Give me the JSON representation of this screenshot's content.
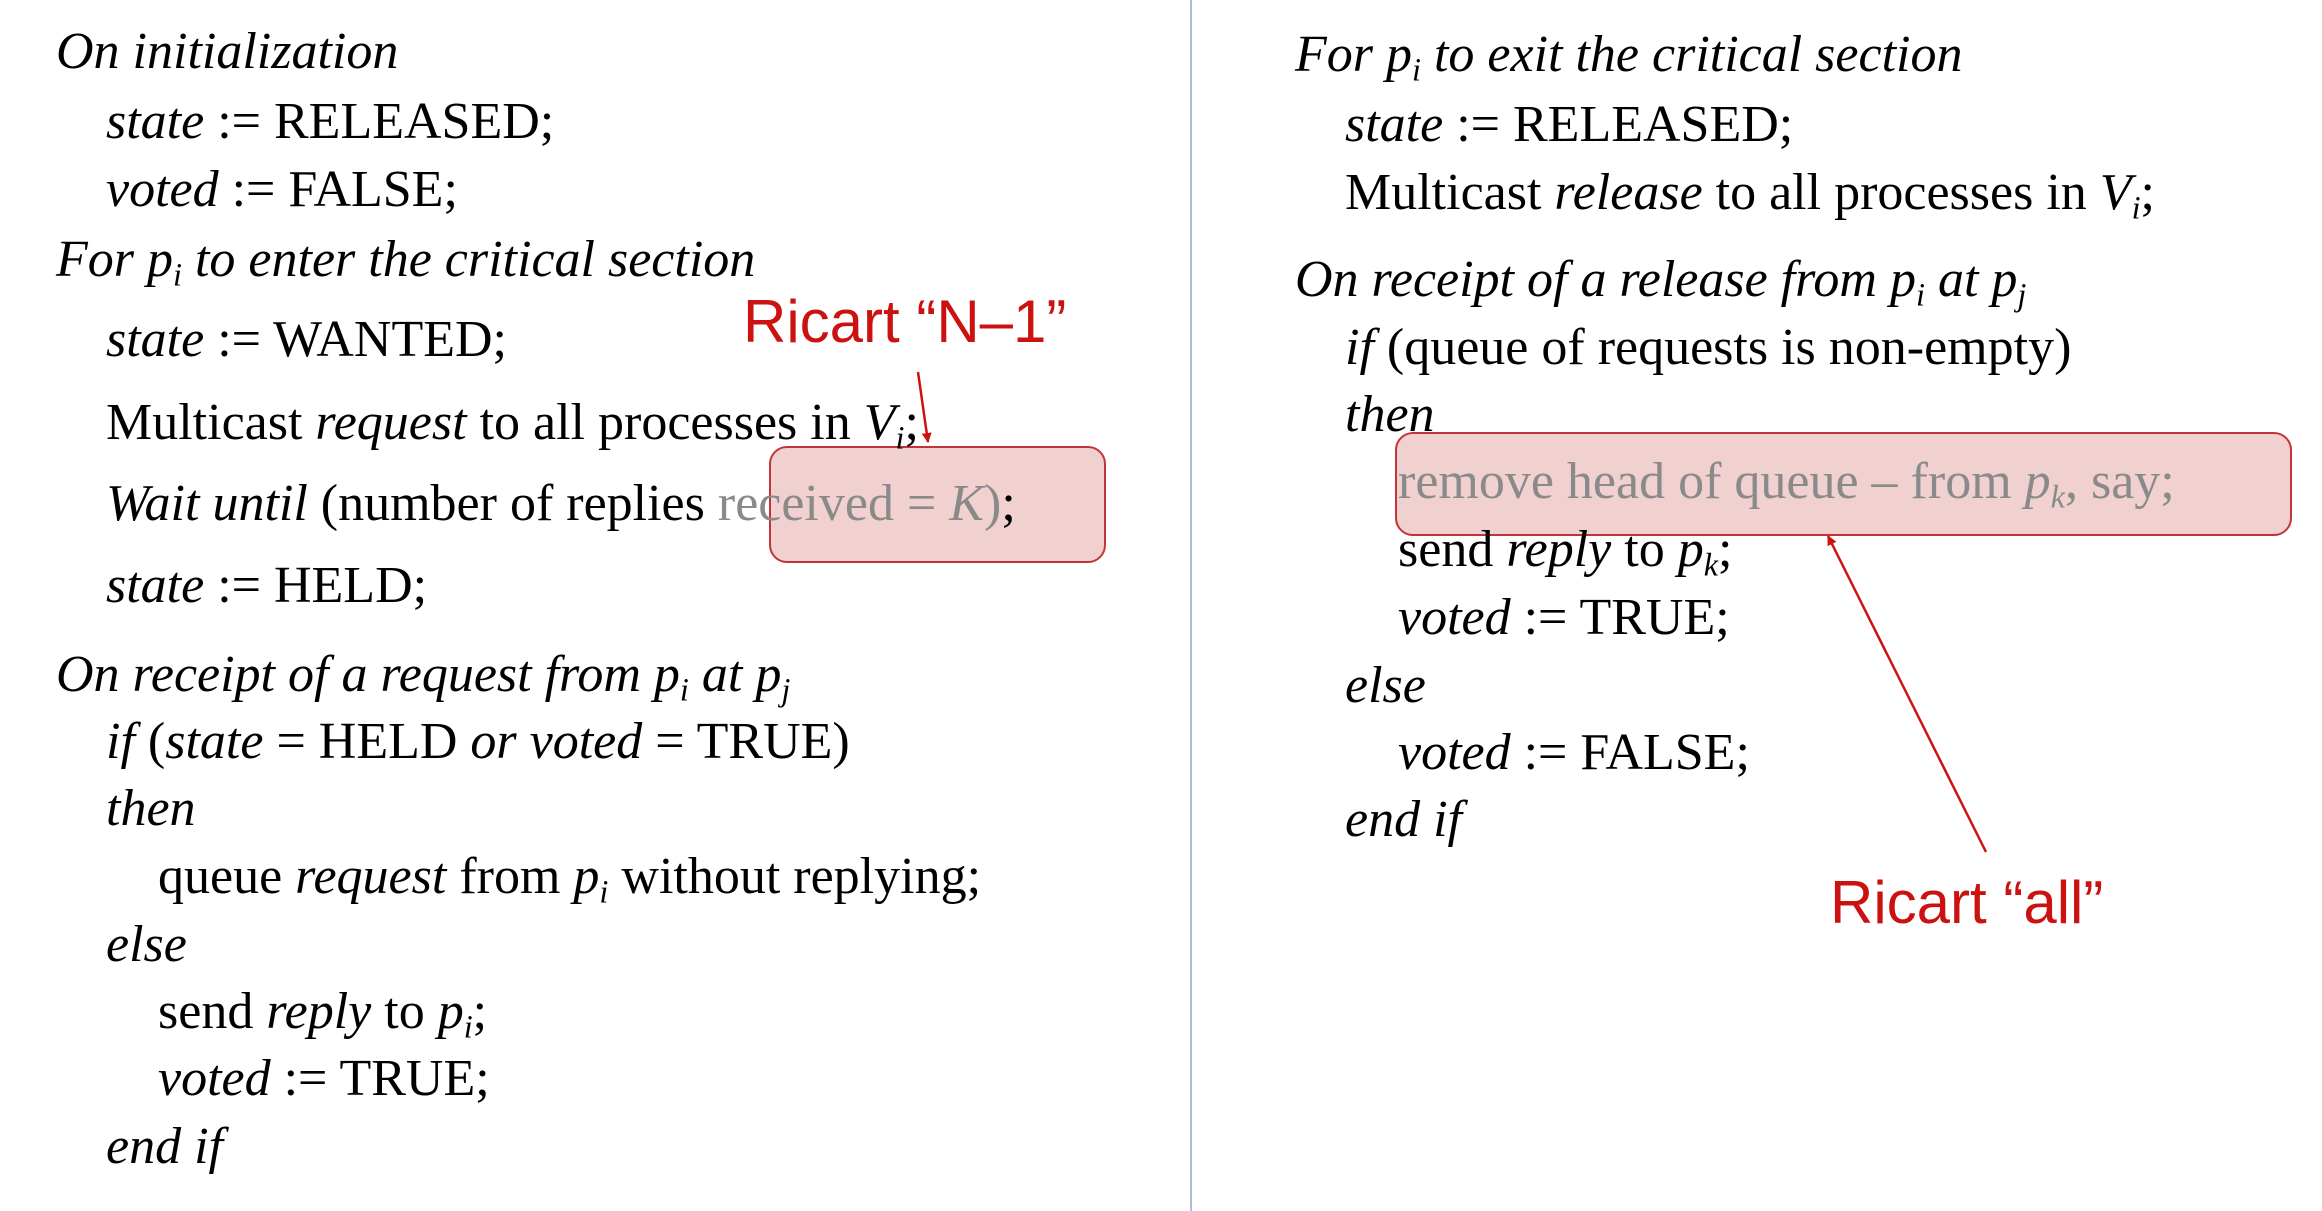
{
  "left": {
    "init_header": "On initialization",
    "init_state_var": "state",
    "init_state_val": ":= RELEASED;",
    "init_voted_var": "voted",
    "init_voted_val": ":= FALSE;",
    "enter_header_a": "For p",
    "enter_header_sub": "i",
    "enter_header_b": " to enter the critical section",
    "wanted_var": "state",
    "wanted_val": ":= WANTED;",
    "mc_a": "Multicast ",
    "mc_b": "request",
    "mc_c": " to all processes in ",
    "mc_d": "V",
    "mc_sub": "i",
    "mc_e": ";",
    "wait_a": "Wait until",
    "wait_b": " (number of replies ",
    "wait_hl_a": "received = ",
    "wait_hl_b": "K",
    "wait_hl_c": ")",
    "wait_end": ";",
    "held_var": "state",
    "held_val": ":= HELD;",
    "recv_header_a": "On receipt of a request from p",
    "recv_header_sub1": "i",
    "recv_header_b": " at p",
    "recv_header_sub2": "j",
    "if_a": "if",
    "if_b": " (",
    "if_c": "state",
    "if_d": " = HELD ",
    "if_e": "or voted",
    "if_f": " = TRUE)",
    "then": "then",
    "queue_a": "queue ",
    "queue_b": "request",
    "queue_c": " from ",
    "queue_d": "p",
    "queue_sub": "i",
    "queue_e": " without replying;",
    "else": "else",
    "send_a": "send ",
    "send_b": "reply",
    "send_c": " to ",
    "send_d": "p",
    "send_sub": "i",
    "send_e": ";",
    "voted_var": "voted",
    "voted_val": ":= TRUE;",
    "endif": "end if"
  },
  "right": {
    "exit_header_a": "For p",
    "exit_header_sub": "i",
    "exit_header_b": " to exit the critical section",
    "released_var": "state",
    "released_val": ":= RELEASED;",
    "mc_a": "Multicast ",
    "mc_b": "release",
    "mc_c": " to all processes in ",
    "mc_d": "V",
    "mc_sub": "i",
    "mc_e": ";",
    "recv_header_a": "On receipt of a release from p",
    "recv_header_sub1": "i",
    "recv_header_b": " at p",
    "recv_header_sub2": "j",
    "if_a": "if",
    "if_b": " (queue of requests is non-empty)",
    "then": "then",
    "remove_a": "remove head of queue – from ",
    "remove_b": "p",
    "remove_sub": "k",
    "remove_c": ", say;",
    "send_a": "send ",
    "send_b": "reply",
    "send_c": " to ",
    "send_d": "p",
    "send_sub": "k",
    "send_e": ";",
    "voted_true_var": "voted",
    "voted_true_val": ":= TRUE;",
    "else": "else",
    "voted_false_var": "voted",
    "voted_false_val": ":= FALSE;",
    "endif": "end if"
  },
  "annotations": {
    "n_minus_1": "Ricart “N–1”",
    "all": "Ricart “all”",
    "color": "#cc1111"
  }
}
